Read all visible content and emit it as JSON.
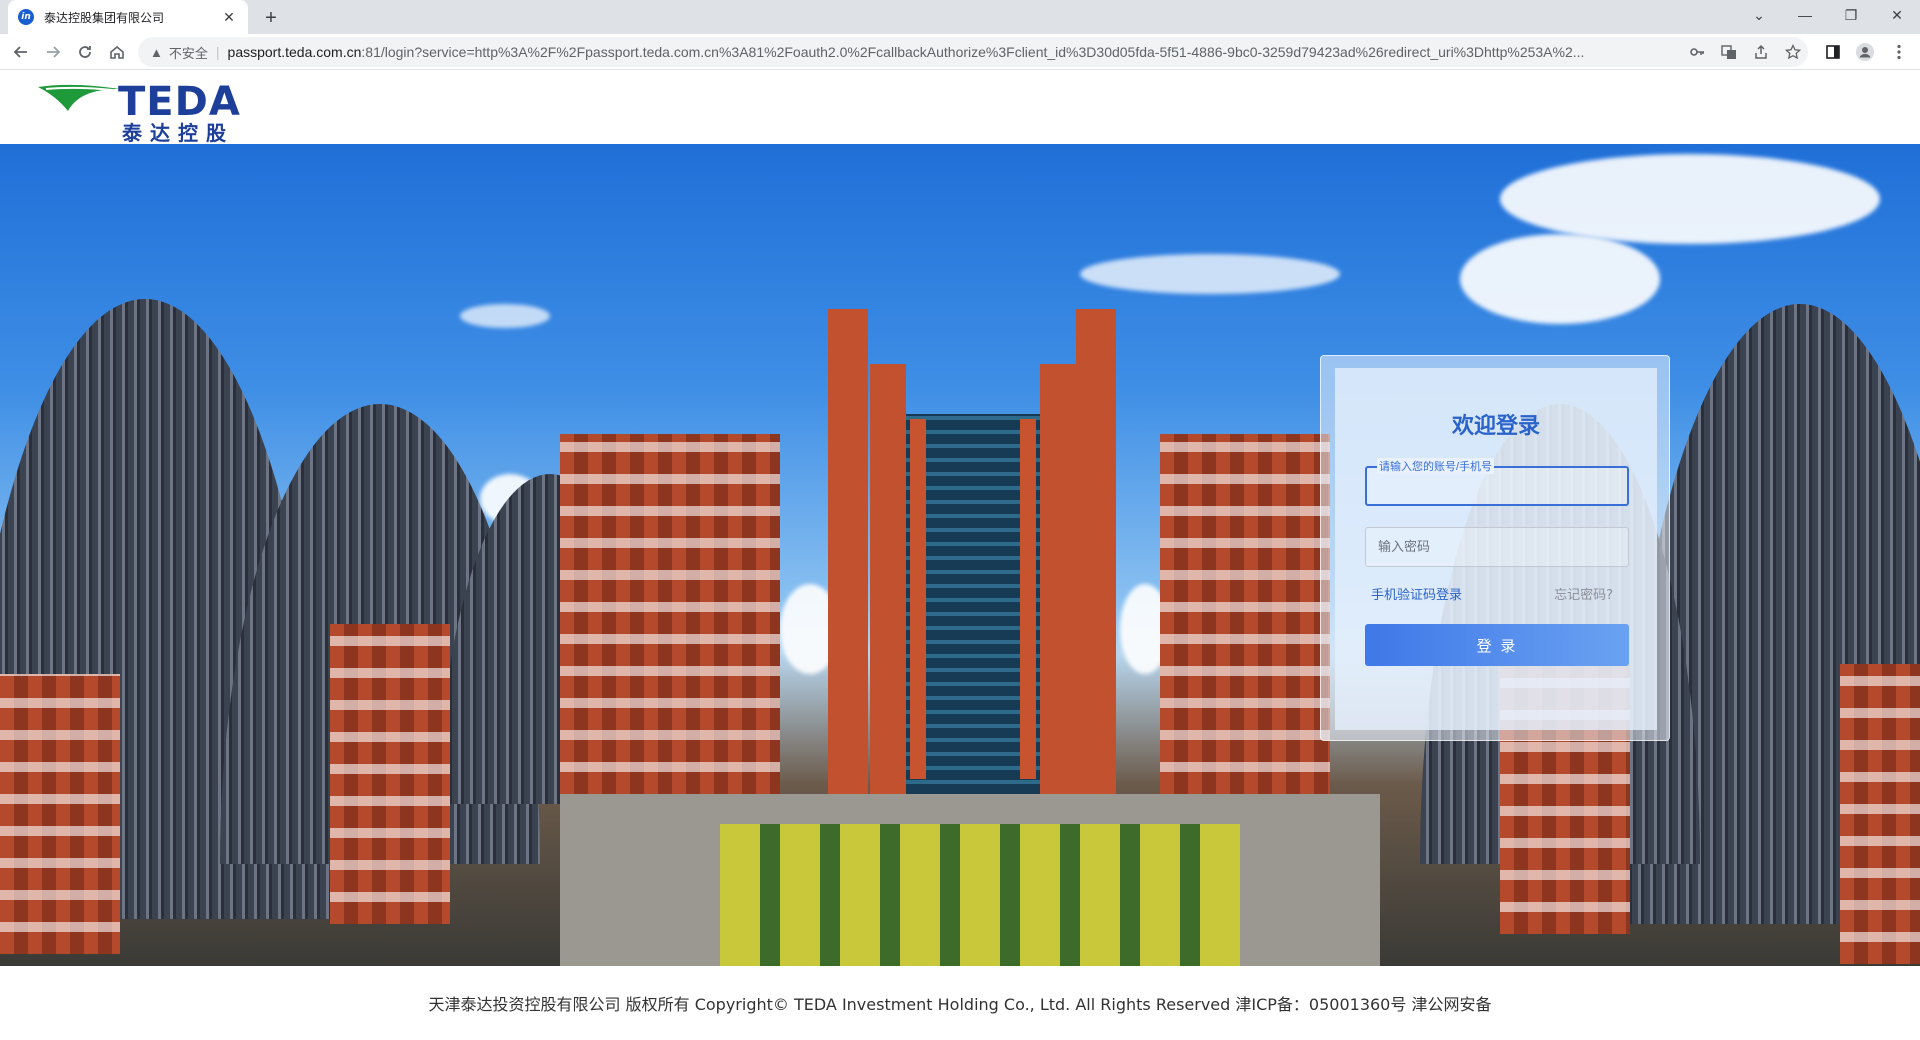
{
  "browser": {
    "tab": {
      "favicon_text": "in",
      "title": "泰达控股集团有限公司"
    },
    "newtab_label": "+",
    "window_controls": {
      "dropdown": "⌄",
      "minimize": "—",
      "restore": "❐",
      "close": "✕"
    },
    "address_bar": {
      "security_warning": "不安全",
      "url_host": "passport.teda.com.cn",
      "url_rest": ":81/login?service=http%3A%2F%2Fpassport.teda.com.cn%3A81%2Foauth2.0%2FcallbackAuthorize%3Fclient_id%3D30d05fda-5f51-4886-9bc0-3259d79423ad%26redirect_uri%3Dhttp%253A%2..."
    },
    "icons": [
      "back-icon",
      "forward-icon",
      "reload-icon",
      "home-icon",
      "key-icon",
      "translate-icon",
      "share-icon",
      "star-icon",
      "sidepanel-icon",
      "profile-icon",
      "menu-icon"
    ]
  },
  "header": {
    "logo_en": "TEDA",
    "logo_cn": "泰达控股",
    "logo_colors": {
      "green": "#1f9a3b",
      "blue": "#1d3f9a"
    }
  },
  "login": {
    "title": "欢迎登录",
    "account_label": "请输入您的账号/手机号",
    "account_value": "",
    "password_placeholder": "输入密码",
    "sms_login": "手机验证码登录",
    "forgot_password": "忘记密码?",
    "submit": "登 录",
    "accent_color": "#3a6fd8"
  },
  "footer": {
    "text": "天津泰达投资控股有限公司 版权所有 Copyright© TEDA Investment Holding Co., Ltd. All Rights Reserved 津ICP备：05001360号 津公网安备"
  }
}
